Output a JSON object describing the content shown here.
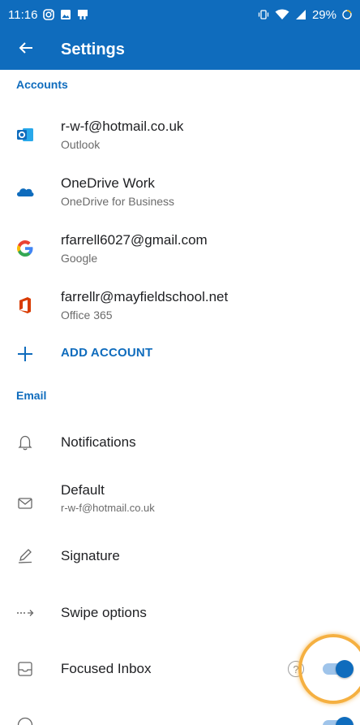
{
  "status_bar": {
    "time": "11:16",
    "battery": "29%"
  },
  "toolbar": {
    "title": "Settings",
    "back_icon": "arrow-left-icon"
  },
  "accounts": {
    "header": "Accounts",
    "items": [
      {
        "icon": "outlook-icon",
        "primary": "r-w-f@hotmail.co.uk",
        "secondary": "Outlook"
      },
      {
        "icon": "onedrive-icon",
        "primary": "OneDrive Work",
        "secondary": "OneDrive for Business"
      },
      {
        "icon": "google-icon",
        "primary": "rfarrell6027@gmail.com",
        "secondary": "Google"
      },
      {
        "icon": "office365-icon",
        "primary": "farrellr@mayfieldschool.net",
        "secondary": "Office 365"
      }
    ],
    "add_label": "ADD ACCOUNT"
  },
  "email": {
    "header": "Email",
    "items": [
      {
        "icon": "bell-icon",
        "primary": "Notifications"
      },
      {
        "icon": "envelope-icon",
        "primary": "Default",
        "secondary": "r-w-f@hotmail.co.uk"
      },
      {
        "icon": "pen-icon",
        "primary": "Signature"
      },
      {
        "icon": "swipe-icon",
        "primary": "Swipe options"
      },
      {
        "icon": "inbox-icon",
        "primary": "Focused Inbox",
        "help": "?",
        "toggle_on": true
      }
    ]
  },
  "colors": {
    "brand": "#0f6cbd",
    "highlight": "#f5b041"
  }
}
